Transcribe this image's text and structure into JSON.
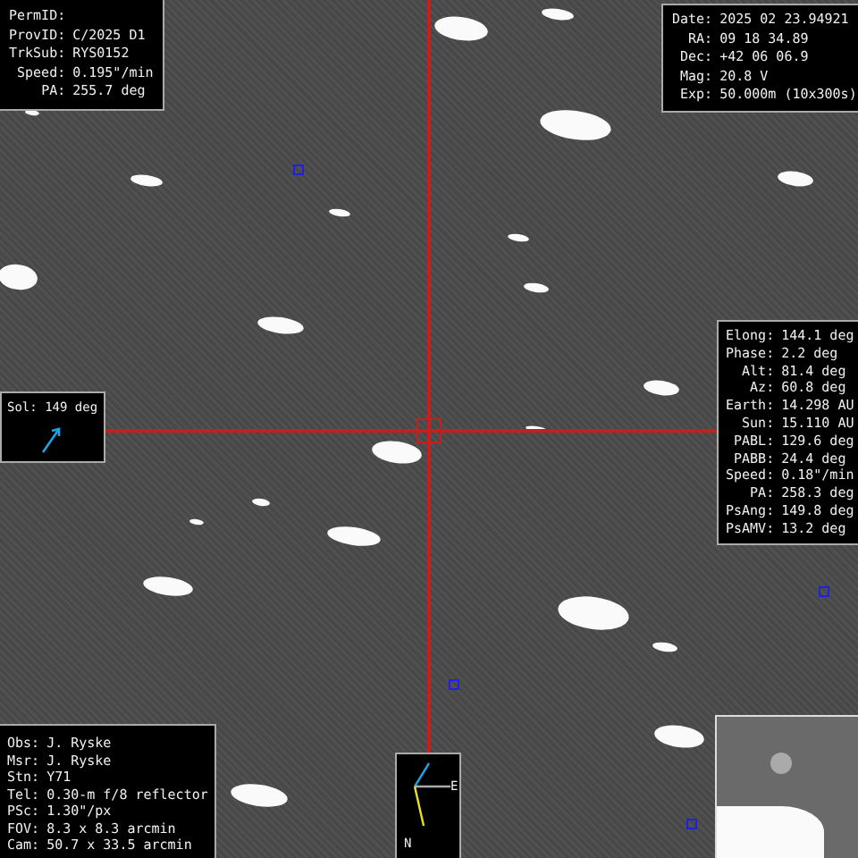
{
  "object_panel": [
    {
      "label": "PermID:"
    },
    {
      "label": "ProvID:",
      "value": "C/2025 D1"
    },
    {
      "label": "TrkSub:",
      "value": "RYS0152"
    },
    {
      "label": "Speed:",
      "value": "0.195\"/min"
    },
    {
      "label": "PA:",
      "value": "255.7 deg"
    }
  ],
  "observation_panel": [
    {
      "label": "Date:",
      "value": "2025 02 23.94921"
    },
    {
      "label": "RA:",
      "value": "09 18 34.89"
    },
    {
      "label": "Dec:",
      "value": "+42 06 06.9"
    },
    {
      "label": "Mag:",
      "value": "20.8 V"
    },
    {
      "label": "Exp:",
      "value": "50.000m (10x300s)"
    }
  ],
  "geometry_panel": [
    {
      "label": "Elong:",
      "value": "144.1 deg"
    },
    {
      "label": "Phase:",
      "value": "2.2 deg"
    },
    {
      "label": "Alt:",
      "value": "81.4 deg"
    },
    {
      "label": "Az:",
      "value": "60.8 deg"
    },
    {
      "label": "Earth:",
      "value": "14.298 AU"
    },
    {
      "label": "Sun:",
      "value": "15.110 AU"
    },
    {
      "label": "PABL:",
      "value": "129.6 deg"
    },
    {
      "label": "PABB:",
      "value": "24.4 deg"
    },
    {
      "label": "Speed:",
      "value": "0.18\"/min"
    },
    {
      "label": "PA:",
      "value": "258.3 deg"
    },
    {
      "label": "PsAng:",
      "value": "149.8 deg"
    },
    {
      "label": "PsAMV:",
      "value": "13.2 deg"
    }
  ],
  "sol_panel": {
    "text": "Sol: 149 deg"
  },
  "station_panel": [
    {
      "label": "Obs:",
      "value": "J. Ryske"
    },
    {
      "label": "Msr:",
      "value": "J. Ryske"
    },
    {
      "label": "Stn:",
      "value": "Y71"
    },
    {
      "label": "Tel:",
      "value": "0.30-m f/8 reflector"
    },
    {
      "label": "PSc:",
      "value": "1.30\"/px"
    },
    {
      "label": "FOV:",
      "value": "8.3 x 8.3 arcmin"
    },
    {
      "label": "Cam:",
      "value": "50.7 x 33.5 arcmin"
    }
  ],
  "compass": {
    "east": "E",
    "north": "N"
  }
}
